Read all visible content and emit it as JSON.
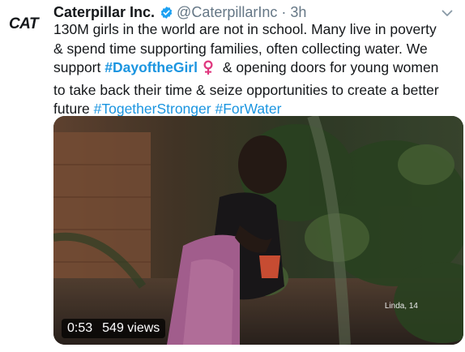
{
  "tweet": {
    "avatar_text": "CAT",
    "author_name": "Caterpillar Inc.",
    "handle": "@CaterpillarInc",
    "separator": "·",
    "time": "3h",
    "text": {
      "line1": "130M girls in the world are not in school. Many live in poverty",
      "line2": "& spend time supporting families, often collecting water. We",
      "line3_pre": "support ",
      "hashtag_dayofthegirl": "#DayoftheGirl",
      "line3_post": " & opening doors for young women",
      "line4": "to take back their time & seize opportunities to create a better",
      "line5_pre": "future ",
      "hashtag_togetherstronger": "#TogetherStronger",
      "hashtag_forwater": "#ForWater"
    }
  },
  "video": {
    "caption": "Linda, 14",
    "duration": "0:53",
    "views": "549 views"
  },
  "colors": {
    "link": "#1b95e0",
    "verified": "#1da1f2",
    "venus": "#e0397f",
    "secondary_text": "#657786"
  },
  "icons": [
    "verified-badge-icon",
    "chevron-down-icon",
    "venus-emoji-icon"
  ]
}
